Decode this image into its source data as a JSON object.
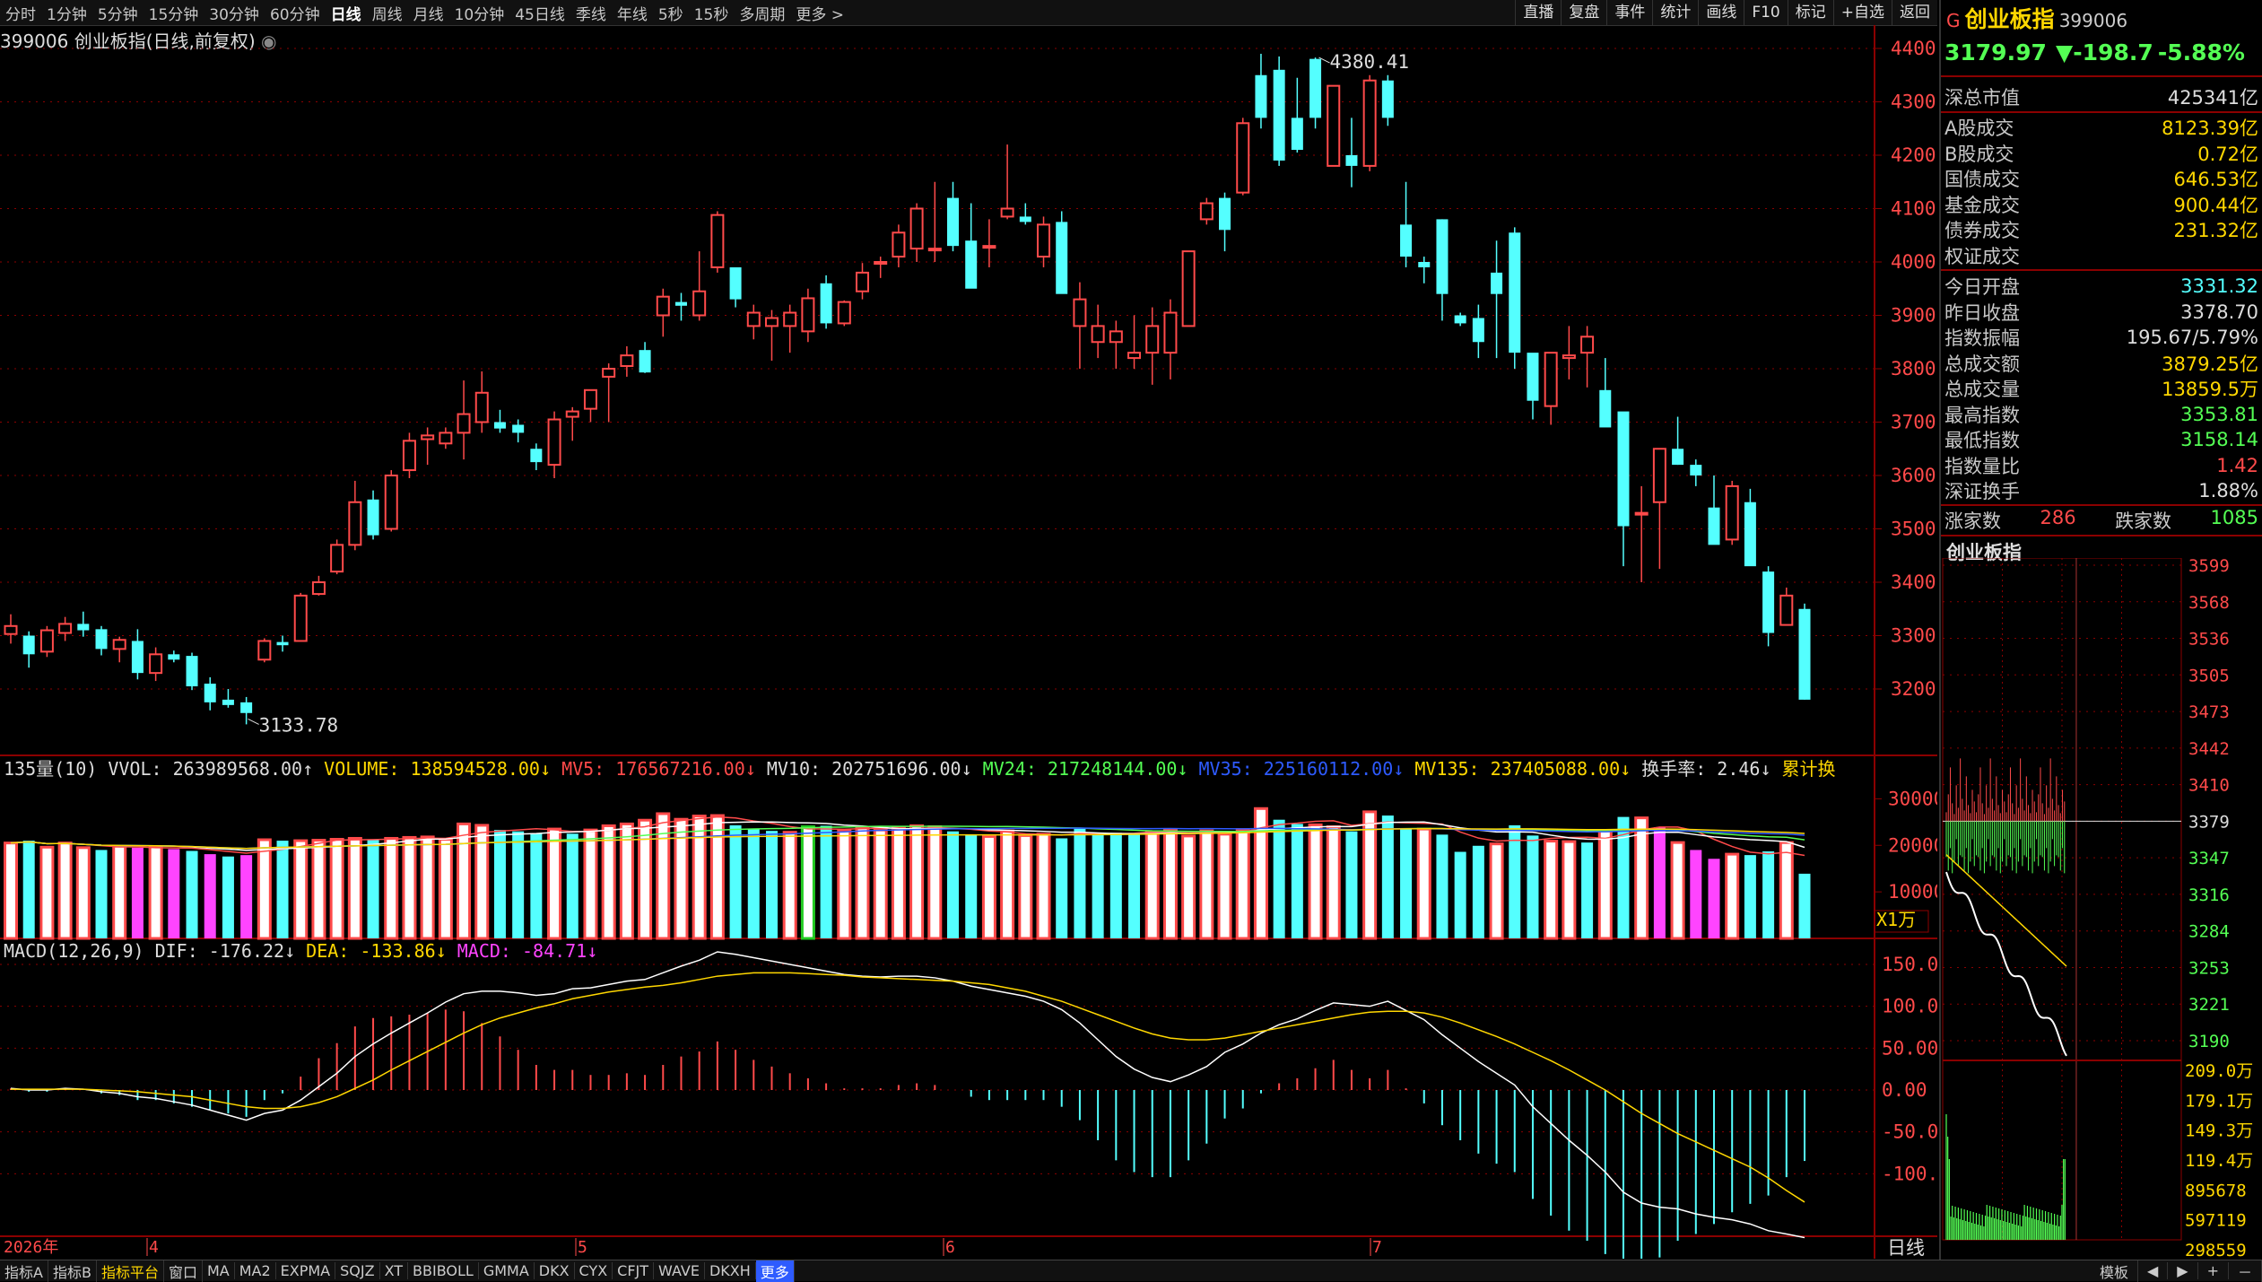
{
  "toolbar": {
    "periods": [
      "分时",
      "1分钟",
      "5分钟",
      "15分钟",
      "30分钟",
      "60分钟",
      "日线",
      "周线",
      "月线",
      "10分钟",
      "45日线",
      "季线",
      "年线",
      "5秒",
      "15秒",
      "多周期",
      "更多 >"
    ],
    "active": "日线",
    "right_buttons": [
      "直播",
      "复盘",
      "事件",
      "统计",
      "画线",
      "F10",
      "标记",
      "+自选",
      "返回"
    ]
  },
  "chart_title": "399006 创业板指(日线,前复权)",
  "price_axis": [
    "4400",
    "4300",
    "4200",
    "4100",
    "4000",
    "3900",
    "3800",
    "3700",
    "3600",
    "3500",
    "3400",
    "3300",
    "3200"
  ],
  "high_mark": "4380.41",
  "low_mark": "3133.78",
  "volume_header": {
    "name": "135量(10)",
    "vvol": "VVOL: 263989568.00",
    "volume": "VOLUME: 138594528.00",
    "mv5": "MV5: 176567216.00",
    "mv10": "MV10: 202751696.00",
    "mv24": "MV24: 217248144.00",
    "mv35": "MV35: 225160112.00",
    "mv135": "MV135: 237405088.00",
    "turnover": "换手率: 2.46",
    "cum": "累计换"
  },
  "volume_axis": [
    "30000",
    "20000",
    "10000"
  ],
  "volume_unit": "X1万",
  "macd_header": {
    "name": "MACD(12,26,9)",
    "dif": "DIF: -176.22",
    "dea": "DEA: -133.86",
    "macd": "MACD: -84.71"
  },
  "macd_axis": [
    "150.0",
    "100.0",
    "50.00",
    "0.00",
    "-50.00",
    "-100.0"
  ],
  "date_axis": {
    "year": "2026年",
    "months": [
      "4",
      "5",
      "6",
      "7"
    ]
  },
  "period_label": "日线",
  "colors": {
    "up": "#ff4a4a",
    "down": "#54ffff",
    "bg": "#000000",
    "grid": "#8b0000"
  },
  "chart_data": {
    "type": "candlestick",
    "ohlc": [
      [
        3303,
        3340,
        3285,
        3318
      ],
      [
        3300,
        3308,
        3240,
        3265
      ],
      [
        3270,
        3318,
        3260,
        3310
      ],
      [
        3305,
        3335,
        3290,
        3322
      ],
      [
        3322,
        3345,
        3298,
        3310
      ],
      [
        3312,
        3318,
        3263,
        3275
      ],
      [
        3275,
        3298,
        3250,
        3292
      ],
      [
        3290,
        3312,
        3218,
        3230
      ],
      [
        3230,
        3278,
        3215,
        3265
      ],
      [
        3265,
        3272,
        3250,
        3255
      ],
      [
        3262,
        3268,
        3198,
        3205
      ],
      [
        3210,
        3222,
        3160,
        3175
      ],
      [
        3180,
        3200,
        3165,
        3170
      ],
      [
        3175,
        3185,
        3133.78,
        3155
      ],
      [
        3255,
        3295,
        3250,
        3290
      ],
      [
        3288,
        3300,
        3270,
        3282
      ],
      [
        3290,
        3380,
        3290,
        3375
      ],
      [
        3378,
        3412,
        3375,
        3400
      ],
      [
        3420,
        3480,
        3415,
        3470
      ],
      [
        3470,
        3590,
        3460,
        3550
      ],
      [
        3555,
        3572,
        3480,
        3488
      ],
      [
        3500,
        3610,
        3495,
        3600
      ],
      [
        3610,
        3680,
        3595,
        3665
      ],
      [
        3668,
        3690,
        3620,
        3675
      ],
      [
        3660,
        3690,
        3650,
        3680
      ],
      [
        3680,
        3778,
        3630,
        3715
      ],
      [
        3700,
        3795,
        3680,
        3755
      ],
      [
        3700,
        3723,
        3680,
        3688
      ],
      [
        3695,
        3705,
        3662,
        3680
      ],
      [
        3650,
        3660,
        3610,
        3625
      ],
      [
        3620,
        3720,
        3595,
        3705
      ],
      [
        3710,
        3728,
        3665,
        3720
      ],
      [
        3725,
        3760,
        3700,
        3760
      ],
      [
        3785,
        3810,
        3700,
        3800
      ],
      [
        3805,
        3842,
        3785,
        3825
      ],
      [
        3835,
        3850,
        3792,
        3793
      ],
      [
        3900,
        3950,
        3860,
        3935
      ],
      [
        3925,
        3942,
        3890,
        3918
      ],
      [
        3900,
        4020,
        3890,
        3945
      ],
      [
        3990,
        4095,
        3980,
        4088
      ],
      [
        3990,
        3980,
        3915,
        3930
      ],
      [
        3880,
        3920,
        3855,
        3905
      ],
      [
        3880,
        3910,
        3815,
        3895
      ],
      [
        3880,
        3920,
        3830,
        3905
      ],
      [
        3870,
        3950,
        3850,
        3932
      ],
      [
        3960,
        3975,
        3875,
        3885
      ],
      [
        3885,
        3928,
        3880,
        3925
      ],
      [
        3945,
        3998,
        3930,
        3980
      ],
      [
        4000,
        4010,
        3970,
        4000
      ],
      [
        4010,
        4070,
        3990,
        4055
      ],
      [
        4025,
        4110,
        4000,
        4100
      ],
      [
        4025,
        4150,
        4000,
        4025
      ],
      [
        4120,
        4150,
        4020,
        4030
      ],
      [
        4040,
        4110,
        3990,
        3950
      ],
      [
        4030,
        4080,
        3990,
        4030
      ],
      [
        4085,
        4220,
        4080,
        4100
      ],
      [
        4085,
        4110,
        4070,
        4075
      ],
      [
        4010,
        4085,
        3990,
        4070
      ],
      [
        4075,
        4095,
        3990,
        3940
      ],
      [
        3880,
        3962,
        3800,
        3930
      ],
      [
        3850,
        3920,
        3820,
        3880
      ],
      [
        3850,
        3890,
        3800,
        3870
      ],
      [
        3820,
        3900,
        3800,
        3830
      ],
      [
        3830,
        3915,
        3770,
        3880
      ],
      [
        3830,
        3930,
        3780,
        3905
      ],
      [
        3880,
        4000,
        3880,
        4020
      ],
      [
        4080,
        4120,
        4070,
        4110
      ],
      [
        4120,
        4130,
        4020,
        4060
      ],
      [
        4130,
        4270,
        4125,
        4260
      ],
      [
        4350,
        4390,
        4250,
        4270
      ],
      [
        4360,
        4385,
        4180,
        4190
      ],
      [
        4270,
        4345,
        4205,
        4210
      ],
      [
        4380.41,
        4383,
        4250,
        4270
      ],
      [
        4180,
        4280,
        4260,
        4330
      ],
      [
        4200,
        4270,
        4140,
        4180
      ],
      [
        4180,
        4350,
        4170,
        4340
      ],
      [
        4340,
        4350,
        4255,
        4270
      ],
      [
        4070,
        4150,
        3990,
        4010
      ],
      [
        4000,
        4010,
        3960,
        3990
      ],
      [
        4080,
        4080,
        3890,
        3940
      ],
      [
        3900,
        3905,
        3880,
        3885
      ],
      [
        3895,
        3920,
        3820,
        3850
      ],
      [
        3980,
        4040,
        3820,
        3940
      ],
      [
        4055,
        4065,
        3800,
        3830
      ],
      [
        3830,
        3810,
        3705,
        3740
      ],
      [
        3730,
        3810,
        3695,
        3830
      ],
      [
        3820,
        3880,
        3780,
        3825
      ],
      [
        3830,
        3880,
        3765,
        3860
      ],
      [
        3760,
        3820,
        3700,
        3690
      ],
      [
        3720,
        3710,
        3430,
        3505
      ],
      [
        3530,
        3580,
        3400,
        3530
      ],
      [
        3550,
        3640,
        3425,
        3650
      ],
      [
        3650,
        3710,
        3620,
        3620
      ],
      [
        3620,
        3630,
        3580,
        3600
      ],
      [
        3540,
        3600,
        3500,
        3470
      ],
      [
        3480,
        3590,
        3470,
        3580
      ],
      [
        3550,
        3575,
        3485,
        3430
      ],
      [
        3420,
        3430,
        3280,
        3305
      ],
      [
        3320,
        3390,
        3320,
        3375
      ],
      [
        3350,
        3360,
        3180,
        3179.97
      ]
    ],
    "volume": [
      [
        20500,
        1
      ],
      [
        21000,
        0
      ],
      [
        19600,
        1
      ],
      [
        20500,
        1
      ],
      [
        19500,
        1
      ],
      [
        19000,
        0
      ],
      [
        19800,
        1
      ],
      [
        19500,
        0
      ],
      [
        19700,
        1
      ],
      [
        19200,
        0
      ],
      [
        18800,
        0
      ],
      [
        18100,
        0
      ],
      [
        17600,
        0
      ],
      [
        17900,
        0
      ],
      [
        21200,
        1
      ],
      [
        21000,
        0
      ],
      [
        21000,
        1
      ],
      [
        21100,
        1
      ],
      [
        21300,
        1
      ],
      [
        21500,
        1
      ],
      [
        21200,
        0
      ],
      [
        21500,
        1
      ],
      [
        21700,
        1
      ],
      [
        21800,
        1
      ],
      [
        21300,
        1
      ],
      [
        24600,
        1
      ],
      [
        24300,
        1
      ],
      [
        23300,
        0
      ],
      [
        23000,
        0
      ],
      [
        22600,
        0
      ],
      [
        23500,
        1
      ],
      [
        22500,
        0
      ],
      [
        23300,
        1
      ],
      [
        24200,
        1
      ],
      [
        24600,
        1
      ],
      [
        25400,
        1
      ],
      [
        26800,
        1
      ],
      [
        25600,
        1
      ],
      [
        26300,
        1
      ],
      [
        26400,
        1
      ],
      [
        24300,
        0
      ],
      [
        23500,
        0
      ],
      [
        23100,
        0
      ],
      [
        22800,
        1
      ],
      [
        24000,
        1
      ],
      [
        24200,
        0
      ],
      [
        23100,
        1
      ],
      [
        23800,
        1
      ],
      [
        23300,
        1
      ],
      [
        23700,
        1
      ],
      [
        24200,
        1
      ],
      [
        24000,
        1
      ],
      [
        23000,
        0
      ],
      [
        22300,
        0
      ],
      [
        21900,
        1
      ],
      [
        23100,
        1
      ],
      [
        22100,
        1
      ],
      [
        22400,
        1
      ],
      [
        21500,
        0
      ],
      [
        23600,
        0
      ],
      [
        22600,
        0
      ],
      [
        22700,
        0
      ],
      [
        22500,
        0
      ],
      [
        22900,
        1
      ],
      [
        23300,
        1
      ],
      [
        22000,
        1
      ],
      [
        23100,
        1
      ],
      [
        22400,
        1
      ],
      [
        23400,
        1
      ],
      [
        27900,
        1
      ],
      [
        25500,
        0
      ],
      [
        24600,
        0
      ],
      [
        24400,
        1
      ],
      [
        24000,
        1
      ],
      [
        23000,
        0
      ],
      [
        27200,
        1
      ],
      [
        26400,
        0
      ],
      [
        23500,
        0
      ],
      [
        23500,
        1
      ],
      [
        22300,
        0
      ],
      [
        18600,
        0
      ],
      [
        19900,
        0
      ],
      [
        20300,
        1
      ],
      [
        24300,
        0
      ],
      [
        22100,
        0
      ],
      [
        20900,
        1
      ],
      [
        20800,
        1
      ],
      [
        20600,
        0
      ],
      [
        23100,
        1
      ],
      [
        26100,
        0
      ],
      [
        25900,
        1
      ],
      [
        23900,
        0
      ],
      [
        20600,
        1
      ],
      [
        19000,
        0
      ],
      [
        17100,
        0
      ],
      [
        18100,
        1
      ],
      [
        17900,
        0
      ],
      [
        18700,
        0
      ],
      [
        20600,
        1
      ],
      [
        13900,
        0
      ]
    ],
    "macd": {
      "dif": [
        2,
        0,
        0,
        2,
        1,
        -2,
        -4,
        -8,
        -10,
        -14,
        -18,
        -24,
        -30,
        -36,
        -28,
        -24,
        -12,
        4,
        20,
        40,
        55,
        68,
        80,
        92,
        105,
        115,
        118,
        118,
        116,
        113,
        115,
        121,
        122,
        126,
        130,
        132,
        140,
        148,
        155,
        165,
        162,
        158,
        154,
        150,
        146,
        142,
        138,
        136,
        135,
        136,
        136,
        134,
        130,
        124,
        120,
        116,
        112,
        106,
        96,
        80,
        60,
        40,
        25,
        15,
        10,
        18,
        28,
        45,
        55,
        68,
        78,
        85,
        95,
        104,
        102,
        100,
        106,
        95,
        84,
        66,
        50,
        34,
        20,
        6,
        -20,
        -40,
        -60,
        -78,
        -98,
        -122,
        -135,
        -140,
        -142,
        -148,
        -152,
        -155,
        -160,
        -168,
        -172,
        -176.22
      ],
      "dea": [
        1,
        1,
        1,
        1,
        1,
        0,
        -1,
        -2,
        -4,
        -6,
        -8,
        -12,
        -16,
        -20,
        -22,
        -22,
        -20,
        -15,
        -8,
        2,
        12,
        24,
        35,
        46,
        57,
        68,
        78,
        86,
        92,
        98,
        103,
        109,
        113,
        117,
        120,
        123,
        125,
        128,
        132,
        136,
        138,
        140,
        140,
        140,
        139,
        138,
        137,
        135,
        134,
        133,
        132,
        131,
        130,
        128,
        126,
        122,
        118,
        112,
        106,
        98,
        90,
        82,
        74,
        67,
        62,
        60,
        60,
        62,
        66,
        70,
        74,
        78,
        82,
        86,
        90,
        93,
        94,
        94,
        92,
        87,
        80,
        72,
        64,
        55,
        45,
        35,
        24,
        12,
        0,
        -14,
        -28,
        -40,
        -52,
        -62,
        -72,
        -82,
        -92,
        -105,
        -120,
        -133.86
      ]
    }
  },
  "right_panel": {
    "flag": "G",
    "name": "创业板指",
    "code": "399006",
    "price": "3179.97",
    "change": "▼-198.7",
    "change_pct": "-5.88%",
    "market_cap_label": "深总市值",
    "market_cap": "425341亿",
    "trade_rows": [
      {
        "k": "A股成交",
        "v": "8123.39亿"
      },
      {
        "k": "B股成交",
        "v": "0.72亿"
      },
      {
        "k": "国债成交",
        "v": "646.53亿"
      },
      {
        "k": "基金成交",
        "v": "900.44亿"
      },
      {
        "k": "债券成交",
        "v": "231.32亿"
      },
      {
        "k": "权证成交",
        "v": ""
      }
    ],
    "stats_rows": [
      {
        "k": "今日开盘",
        "v": "3331.32",
        "c": "#54ffff"
      },
      {
        "k": "昨日收盘",
        "v": "3378.70",
        "c": "#ddd"
      },
      {
        "k": "指数振幅",
        "v": "195.67/5.79%",
        "c": "#ddd"
      },
      {
        "k": "总成交额",
        "v": "3879.25亿",
        "c": "#ffd700"
      },
      {
        "k": "总成交量",
        "v": "13859.5万",
        "c": "#ffd700"
      },
      {
        "k": "最高指数",
        "v": "3353.81",
        "c": "#54ff54"
      },
      {
        "k": "最低指数",
        "v": "3158.14",
        "c": "#54ff54"
      },
      {
        "k": "指数量比",
        "v": "1.42",
        "c": "#ff4a4a"
      },
      {
        "k": "深证换手",
        "v": "1.88%",
        "c": "#ddd"
      }
    ],
    "up_label": "涨家数",
    "up_count": "286",
    "down_label": "跌家数",
    "down_count": "1085",
    "mini_title": "创业板指",
    "mini_axis": [
      "3599",
      "3568",
      "3536",
      "3505",
      "3473",
      "3442",
      "3410",
      "3379",
      "3347",
      "3316",
      "3284",
      "3253",
      "3221",
      "3190",
      "209.0万",
      "179.1万",
      "149.3万",
      "119.4万",
      "895678",
      "597119",
      "298559"
    ]
  },
  "bottom_tabs": [
    "指标A",
    "指标B",
    "指标平台",
    "窗口",
    "MA",
    "MA2",
    "EXPMA",
    "SQJZ",
    "XT",
    "BBIBOLL",
    "GMMA",
    "DKX",
    "CYX",
    "CFJT",
    "WAVE",
    "DKXH",
    "更多"
  ],
  "bottom_active": "指标平台",
  "bottom_right": [
    "模板",
    "◀",
    "▶",
    "+",
    "－"
  ]
}
